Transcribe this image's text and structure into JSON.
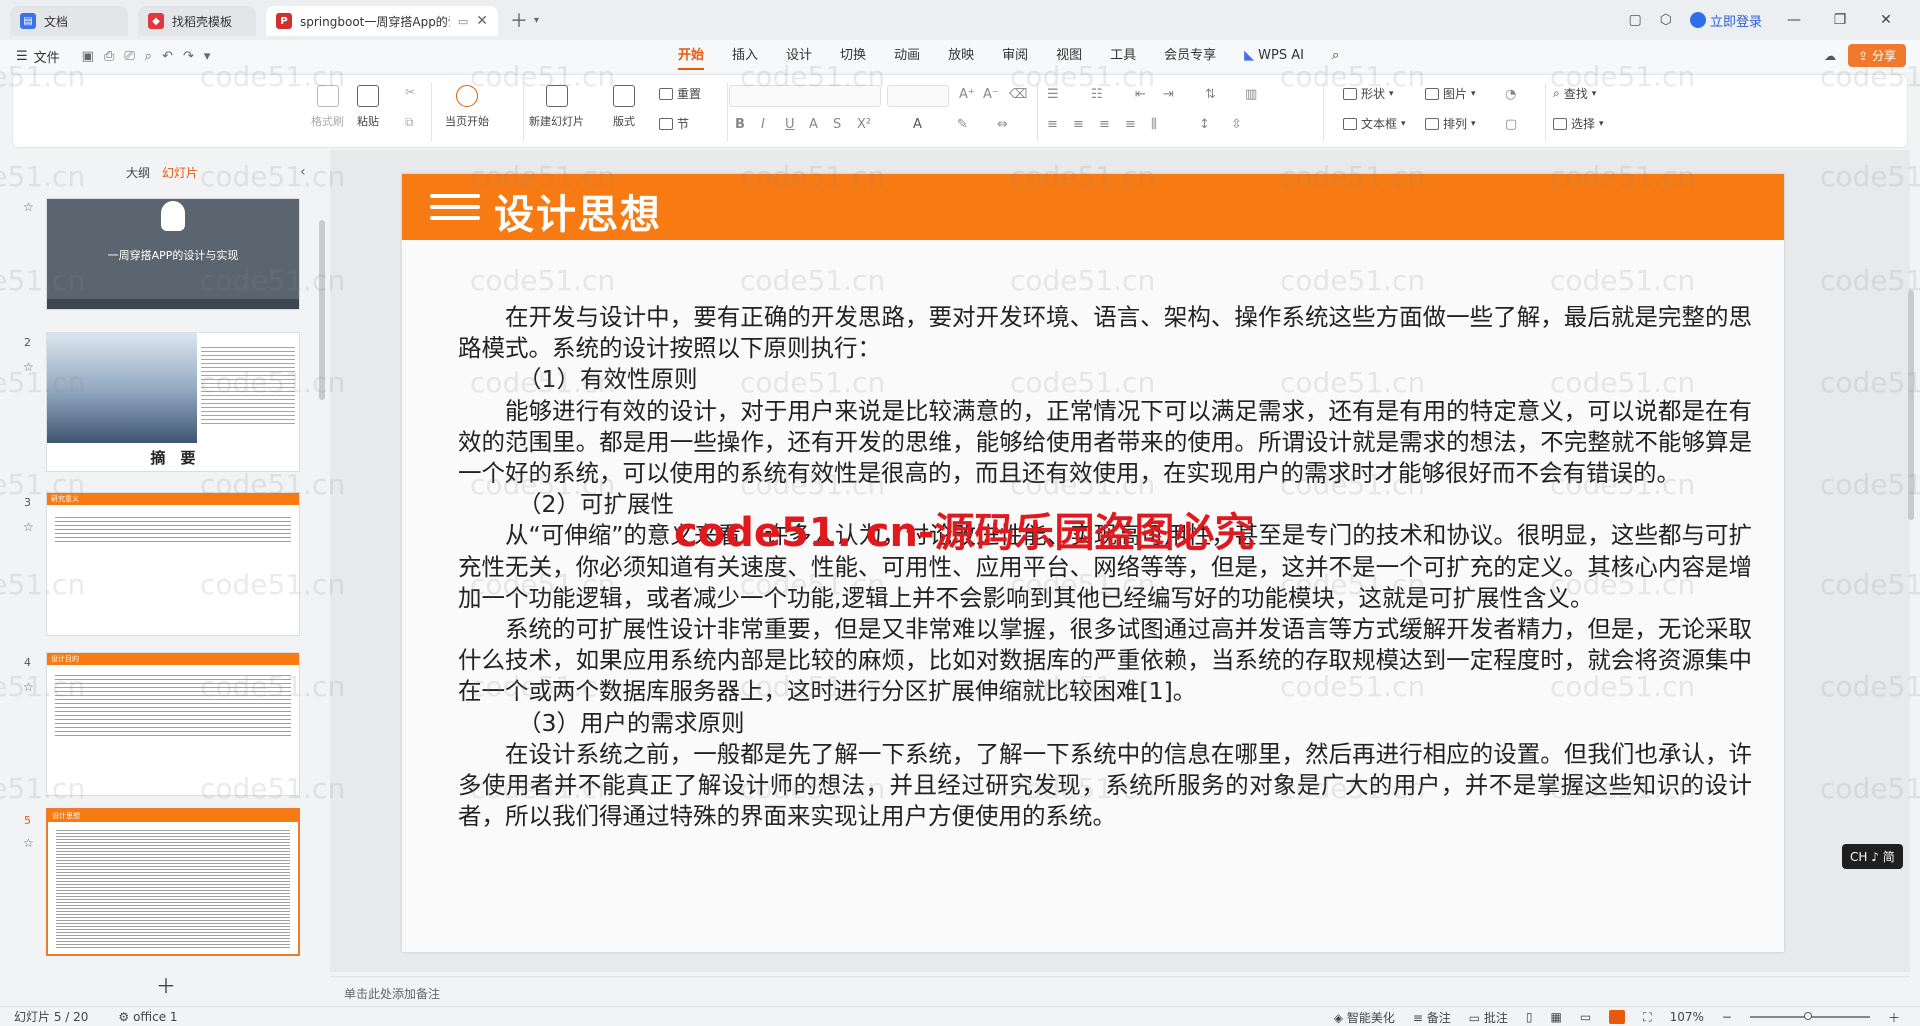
{
  "tabs": [
    {
      "label": "文档",
      "color": "#3a72e8"
    },
    {
      "label": "找稻壳模板",
      "color": "#e0383e"
    },
    {
      "label": "springboot一周穿搭App的设",
      "color": "#d0312d"
    }
  ],
  "login_label": "立即登录",
  "file_menu": "文件",
  "menus": [
    "开始",
    "插入",
    "设计",
    "切换",
    "动画",
    "放映",
    "审阅",
    "视图",
    "工具",
    "会员专享"
  ],
  "wps_ai": "WPS AI",
  "share_label": "分享",
  "ribbon": {
    "format_painter": "格式刷",
    "paste": "粘贴",
    "start_show": "当页开始",
    "new_slide": "新建幻灯片",
    "layout": "版式",
    "reset": "重置",
    "section": "节",
    "shape": "形状",
    "picture": "图片",
    "textbox": "文本框",
    "arrange": "排列",
    "find": "查找",
    "select": "选择"
  },
  "left_panel": {
    "tab_outline": "大纲",
    "tab_slides": "幻灯片",
    "slides": [
      {
        "num": "1",
        "title": "一周穿搭APP的设计与实现"
      },
      {
        "num": "2",
        "title": "摘　要"
      },
      {
        "num": "3",
        "title": "研究意义"
      },
      {
        "num": "4",
        "title": "设计目的"
      },
      {
        "num": "5",
        "title": "设计思想"
      }
    ]
  },
  "slide": {
    "title": "设计思想",
    "paragraphs": [
      {
        "cls": "ind",
        "text": "在开发与设计中，要有正确的开发思路，要对开发环境、语言、架构、操作系统这些方面做一些了解，最后就是完整的思路模式。系统的设计按照以下原则执行："
      },
      {
        "cls": "sub",
        "text": "（1）有效性原则"
      },
      {
        "cls": "ind",
        "text": "能够进行有效的设计，对于用户来说是比较满意的，正常情况下可以满足需求，还有是有用的特定意义，可以说都是在有效的范围里。都是用一些操作，还有开发的思维，能够给使用者带来的使用。所谓设计就是需求的想法，不完整就不能够算是一个好的系统，可以使用的系统有效性是很高的，而且还有效使用，在实现用户的需求时才能够很好而不会有错误的。"
      },
      {
        "cls": "sub",
        "text": "（2）可扩展性"
      },
      {
        "cls": "ind",
        "text": "从“可伸缩”的意义来看，许多人认为，讨论改进性能、实现高可用性，甚至是专门的技术和协议。很明显，这些都与可扩充性无关，你必须知道有关速度、性能、可用性、应用平台、网络等等，但是，这并不是一个可扩充的定义。其核心内容是增加一个功能逻辑，或者减少一个功能,逻辑上并不会影响到其他已经编写好的功能模块，这就是可扩展性含义。"
      },
      {
        "cls": "ind",
        "text": "系统的可扩展性设计非常重要，但是又非常难以掌握，很多试图通过高并发语言等方式缓解开发者精力，但是，无论采取什么技术，如果应用系统内部是比较的麻烦，比如对数据库的严重依赖，当系统的存取规模达到一定程度时，就会将资源集中在一个或两个数据库服务器上，这时进行分区扩展伸缩就比较困难[1]。"
      },
      {
        "cls": "sub",
        "text": "（3）用户的需求原则"
      },
      {
        "cls": "ind",
        "text": "在设计系统之前，一般都是先了解一下系统，了解一下系统中的信息在哪里，然后再进行相应的设置。但我们也承认，许多使用者并不能真正了解设计师的想法，并且经过研究发现，系统所服务的对象是广大的用户，并不是掌握这些知识的设计者，所以我们得通过特殊的界面来实现让用户方便使用的系统。"
      }
    ]
  },
  "watermark_red": "code51. cn-源码乐园盗图必究",
  "watermark_grey": "code51.cn",
  "ime_badge": "CH ♪ 简",
  "notes_placeholder": "单击此处添加备注",
  "status": {
    "slide_counter": "幻灯片 5 / 20",
    "theme": "office 1",
    "beautify": "智能美化",
    "notes": "备注",
    "comments": "批注",
    "zoom": "107%"
  }
}
